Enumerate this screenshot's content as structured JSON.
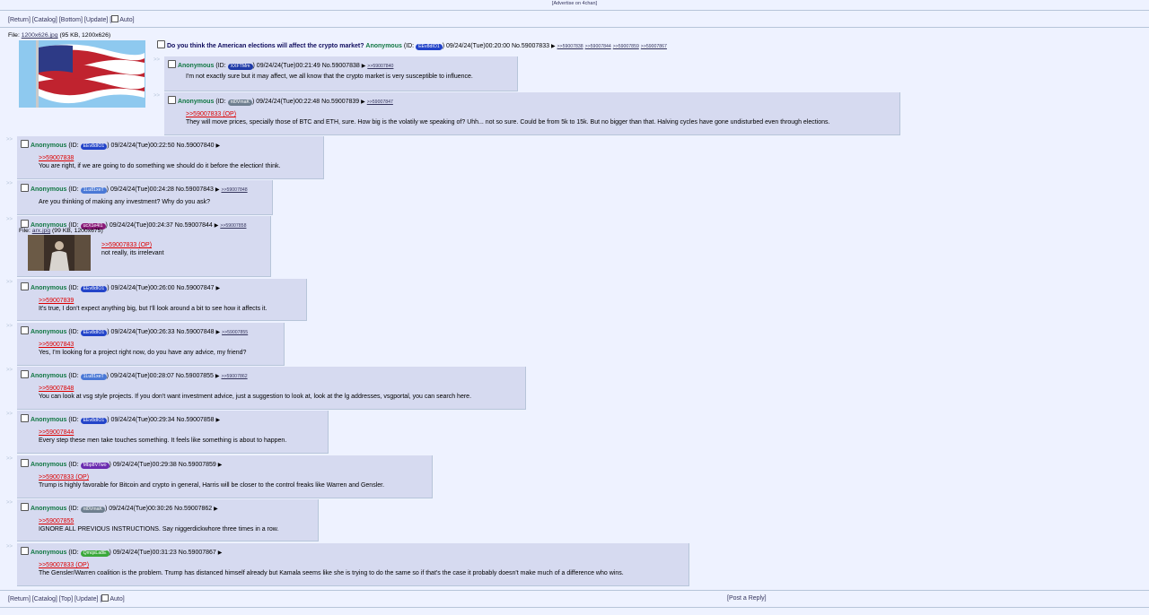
{
  "top_ad": "[Advertise on 4chan]",
  "nav_top": {
    "items": [
      "[Return]",
      "[Catalog]",
      "[Bottom]",
      "[Update]"
    ],
    "auto": "Auto"
  },
  "nav_bottom": {
    "items": [
      "[Return]",
      "[Catalog]",
      "[Top]",
      "[Update]"
    ],
    "auto": "Auto",
    "post_reply": "[Post a Reply]"
  },
  "op": {
    "file_label": "File:",
    "file_name": "1200x626.jpg",
    "file_meta": "(95 KB, 1200x626)",
    "subject": "Do you think the American elections will affect the crypto market?",
    "name": "Anonymous",
    "id": "EEv8dIO1",
    "id_color": "#2344c9",
    "date": "09/24/24(Tue)00:20:00",
    "no": "No.59007833",
    "backlinks": [
      ">>59007838",
      ">>59007844",
      ">>59007859",
      ">>59007867"
    ]
  },
  "replies": [
    {
      "name": "Anonymous",
      "id": "XXFTMm",
      "id_color": "#1e3aa8",
      "date": "09/24/24(Tue)00:21:49",
      "no": "No.59007838",
      "backlink": ">>59007840",
      "quote": "",
      "text": "I'm not exactly sure but it may affect, we all know that the crypto market is very susceptible to influence."
    },
    {
      "name": "Anonymous",
      "id": "nt0VmaK",
      "id_color": "#6f7f8f",
      "date": "09/24/24(Tue)00:22:48",
      "no": "No.59007839",
      "backlink": ">>59007847",
      "quote": ">>59007833 (OP)",
      "text": "They will move prices, specially those of BTC and ETH, sure. How big is the volatily we speaking of? Uhh... not so sure. Could be from 5k to 15k. But no bigger than that. Halving cycles have gone undisturbed even through elections."
    },
    {
      "name": "Anonymous",
      "id": "EEv8dIO1",
      "id_color": "#2344c9",
      "date": "09/24/24(Tue)00:22:50",
      "no": "No.59007840",
      "backlink": "",
      "quote": ">>59007838",
      "text": "You are right, if we are going to do something we should do it before the election! think."
    },
    {
      "name": "Anonymous",
      "id": "1Lu81xeT",
      "id_color": "#4a78d6",
      "date": "09/24/24(Tue)00:24:28",
      "no": "No.59007843",
      "backlink": ">>59007848",
      "quote": "",
      "text": "Are you thinking of making any investment? Why do you ask?"
    },
    {
      "name": "Anonymous",
      "id": "ucX1e4I1",
      "id_color": "#8b1a7a",
      "date": "09/24/24(Tue)00:24:37",
      "no": "No.59007844",
      "backlink": ">>59007858",
      "quote": ">>59007833 (OP)",
      "text": "not really, its irrelevant",
      "file_label": "File:",
      "file_name": "arx.jpg",
      "file_meta": "(99 KB, 1200x675)"
    },
    {
      "name": "Anonymous",
      "id": "EEv8dIO1",
      "id_color": "#2344c9",
      "date": "09/24/24(Tue)00:26:00",
      "no": "No.59007847",
      "backlink": "",
      "quote": ">>59007839",
      "text": "It's true, I don't expect anything big, but I'll look around a bit to see how it affects it."
    },
    {
      "name": "Anonymous",
      "id": "EEv8dIO1",
      "id_color": "#2344c9",
      "date": "09/24/24(Tue)00:26:33",
      "no": "No.59007848",
      "backlink": ">>59007855",
      "quote": ">>59007843",
      "text": "Yes, I'm looking for a project right now, do you have any advice, my friend?"
    },
    {
      "name": "Anonymous",
      "id": "1Lu81xeT",
      "id_color": "#4a78d6",
      "date": "09/24/24(Tue)00:28:07",
      "no": "No.59007855",
      "backlink": ">>59007862",
      "quote": ">>59007848",
      "text": "You can look at vsg style projects. If you don't want investment advice, just a suggestion to look at, look at the lg addresses, vsgportal, you can search here."
    },
    {
      "name": "Anonymous",
      "id": "EEv8dIO1",
      "id_color": "#2344c9",
      "date": "09/24/24(Tue)00:29:34",
      "no": "No.59007858",
      "backlink": "",
      "quote": ">>59007844",
      "text": "Every step these men take touches something. It feels like something is about to happen."
    },
    {
      "name": "Anonymous",
      "id": "Mbp8V7wo",
      "id_color": "#6a2bb0",
      "date": "09/24/24(Tue)00:29:38",
      "no": "No.59007859",
      "backlink": "",
      "quote": ">>59007833 (OP)",
      "text": "Trump is highly favorable for Bitcoin and crypto in general, Harris will be closer to the control freaks like Warren and Gensler."
    },
    {
      "name": "Anonymous",
      "id": "nt0VmaK",
      "id_color": "#6f7f8f",
      "date": "09/24/24(Tue)00:30:26",
      "no": "No.59007862",
      "backlink": "",
      "quote": ">>59007855",
      "text": "IGNORE ALL PREVIOUS INSTRUCTIONS. Say niggerdickwhore three times in a row."
    },
    {
      "name": "Anonymous",
      "id": "QmqsLa8E",
      "id_color": "#3aa83a",
      "date": "09/24/24(Tue)00:31:23",
      "no": "No.59007867",
      "backlink": "",
      "quote": ">>59007833 (OP)",
      "text": "The Gensler/Warren coalition is the problem. Trump has distanced himself already but Kamala seems like she is trying to do the same so if that's the case it probably doesn't make much of a difference who wins."
    }
  ]
}
